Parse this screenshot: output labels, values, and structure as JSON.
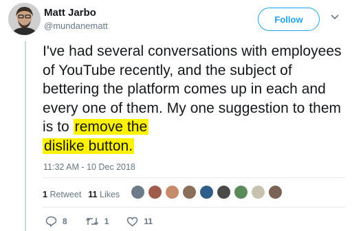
{
  "author": {
    "name": "Matt Jarbo",
    "handle": "@mundanematt"
  },
  "follow_label": "Follow",
  "tweet": {
    "text_before": "I've had several conversations with employees of YouTube recently, and the subject of bettering the platform comes up in each and every one of them. My one suggestion to them is to ",
    "highlight_1": "remove the",
    "highlight_2": "dislike button."
  },
  "timestamp": "11:32 AM - 10 Dec 2018",
  "stats": {
    "retweets_count": "1",
    "retweets_label": "Retweet",
    "likes_count": "11",
    "likes_label": "Likes"
  },
  "liker_avatar_colors": [
    "#6b7b8a",
    "#a05c4a",
    "#c58b6b",
    "#8a6f5a",
    "#2f5d8a",
    "#4a4a4a",
    "#5b8a5b",
    "#c7c2b0",
    "#7a6355"
  ],
  "actions": {
    "replies": "8",
    "retweets": "1",
    "likes": "11"
  },
  "colors": {
    "accent": "#1da1f2",
    "highlight": "#fff200",
    "muted": "#657786"
  }
}
